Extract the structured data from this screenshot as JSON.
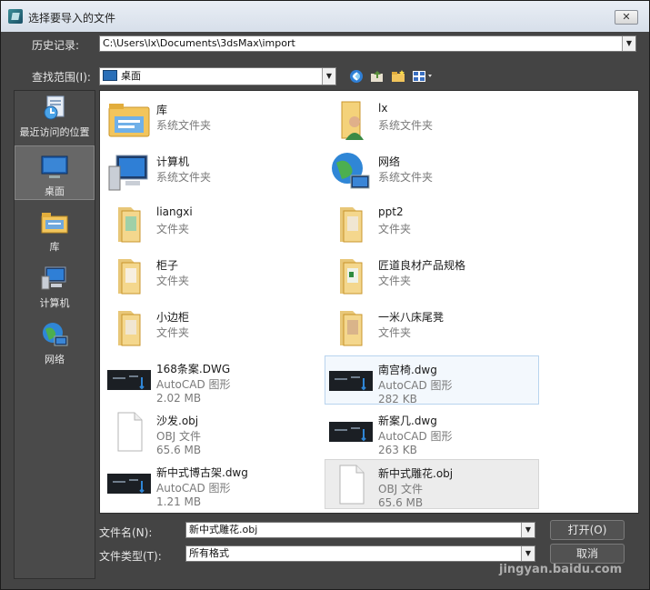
{
  "window": {
    "title": "选择要导入的文件",
    "close_label": "✕"
  },
  "history": {
    "label": "历史记录:",
    "value": "C:\\Users\\lx\\Documents\\3dsMax\\import"
  },
  "look_in": {
    "label": "查找范围(I):",
    "value": "桌面"
  },
  "toolbar": {
    "icons": [
      "back-icon",
      "up-folder-icon",
      "new-folder-icon",
      "view-menu-icon"
    ]
  },
  "places": [
    {
      "label": "最近访问的位置",
      "icon": "recent-places-icon"
    },
    {
      "label": "桌面",
      "icon": "desktop-icon",
      "selected": true
    },
    {
      "label": "库",
      "icon": "library-icon"
    },
    {
      "label": "计算机",
      "icon": "computer-icon"
    },
    {
      "label": "网络",
      "icon": "network-icon"
    }
  ],
  "files": [
    {
      "name": "库",
      "type": "系统文件夹",
      "size": "",
      "icon": "library-folder-icon"
    },
    {
      "name": "lx",
      "type": "系统文件夹",
      "size": "",
      "icon": "user-folder-icon"
    },
    {
      "name": "计算机",
      "type": "系统文件夹",
      "size": "",
      "icon": "computer-icon"
    },
    {
      "name": "网络",
      "type": "系统文件夹",
      "size": "",
      "icon": "network-globe-icon"
    },
    {
      "name": "liangxi",
      "type": "文件夹",
      "size": "",
      "icon": "folder-icon"
    },
    {
      "name": "ppt2",
      "type": "文件夹",
      "size": "",
      "icon": "folder-icon"
    },
    {
      "name": "柜子",
      "type": "文件夹",
      "size": "",
      "icon": "folder-icon"
    },
    {
      "name": "匠道良材产品规格",
      "type": "文件夹",
      "size": "",
      "icon": "folder-icon"
    },
    {
      "name": "小边柜",
      "type": "文件夹",
      "size": "",
      "icon": "folder-icon"
    },
    {
      "name": "一米八床尾凳",
      "type": "文件夹",
      "size": "",
      "icon": "folder-icon"
    },
    {
      "name": "168条案.DWG",
      "type": "AutoCAD 图形",
      "size": "2.02 MB",
      "icon": "dwg-thumbnail-icon"
    },
    {
      "name": "南宫椅.dwg",
      "type": "AutoCAD 图形",
      "size": "282 KB",
      "icon": "dwg-thumbnail-icon"
    },
    {
      "name": "沙发.obj",
      "type": "OBJ 文件",
      "size": "65.6 MB",
      "icon": "blank-file-icon"
    },
    {
      "name": "新案几.dwg",
      "type": "AutoCAD 图形",
      "size": "263 KB",
      "icon": "dwg-thumbnail-icon"
    },
    {
      "name": "新中式博古架.dwg",
      "type": "AutoCAD 图形",
      "size": "1.21 MB",
      "icon": "dwg-thumbnail-icon"
    },
    {
      "name": "新中式雕花.obj",
      "type": "OBJ 文件",
      "size": "65.6 MB",
      "icon": "blank-file-icon"
    }
  ],
  "filename": {
    "label": "文件名(N):",
    "value": "新中式雕花.obj"
  },
  "filetype": {
    "label": "文件类型(T):",
    "value": "所有格式"
  },
  "buttons": {
    "open": "打开(O)",
    "cancel": "取消"
  },
  "watermark": "jingyan.baidu.com",
  "colors": {
    "dialog_bg": "#444444",
    "hover_highlight": "#f3f8fd",
    "selected_highlight": "#ececec",
    "folder_yellow": "#f2c55c"
  }
}
